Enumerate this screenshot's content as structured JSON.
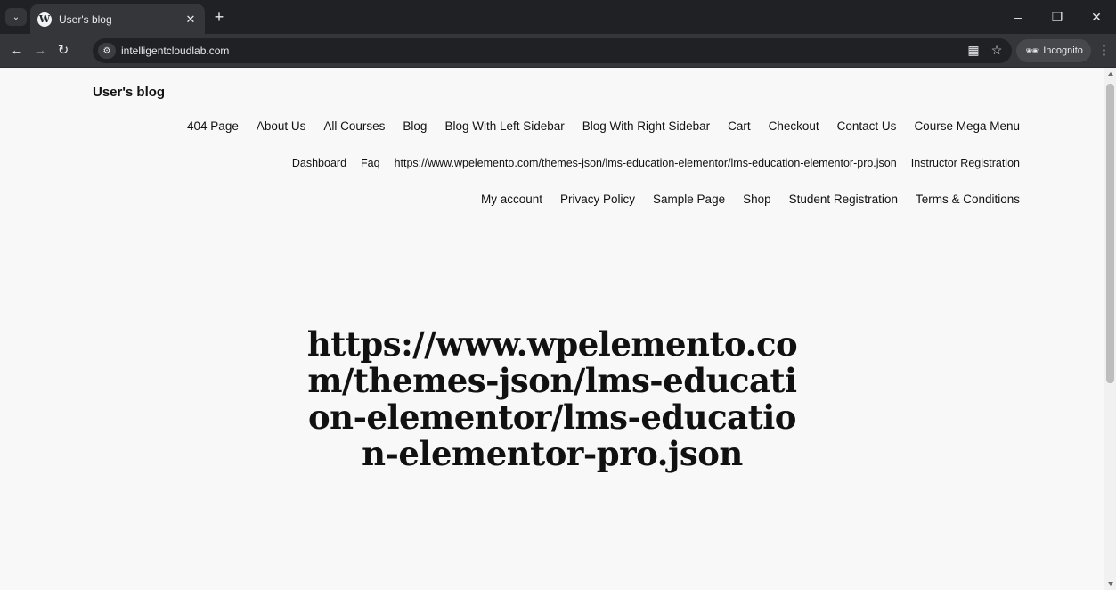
{
  "browser": {
    "tab_title": "User's blog",
    "url": "intelligentcloudlab.com",
    "incognito_label": "Incognito",
    "favicon_letter": "W",
    "icons": {
      "tab_search": "chevron-down-icon",
      "close": "close-icon",
      "new_tab": "plus-icon",
      "back": "arrow-left-icon",
      "forward": "arrow-right-icon",
      "reload": "reload-icon",
      "site_info": "tune-icon",
      "qr": "qr-code-icon",
      "bookmark": "star-icon",
      "incognito": "incognito-icon",
      "menu": "kebab-menu-icon",
      "minimize": "minimize-icon",
      "restore": "restore-icon",
      "window_close": "close-icon"
    }
  },
  "site": {
    "title": "User's blog",
    "nav_row1": [
      "404 Page",
      "About Us",
      "All Courses",
      "Blog",
      "Blog With Left Sidebar",
      "Blog With Right Sidebar",
      "Cart",
      "Checkout",
      "Contact Us",
      "Course Mega Menu"
    ],
    "nav_row2": [
      "Dashboard",
      "Faq",
      "https://www.wpelemento.com/themes-json/lms-education-elementor/lms-education-elementor-pro.json",
      "Instructor Registration"
    ],
    "nav_row3": [
      "My account",
      "Privacy Policy",
      "Sample Page",
      "Shop",
      "Student Registration",
      "Terms & Conditions"
    ]
  },
  "post": {
    "title": "https://www.wpelemento.com/themes-json/lms-education-elementor/lms-education-elementor-pro.json"
  },
  "colors": {
    "chrome_dark": "#202124",
    "toolbar": "#35363a",
    "page_background": "#f8f8f8",
    "text": "#111111"
  }
}
